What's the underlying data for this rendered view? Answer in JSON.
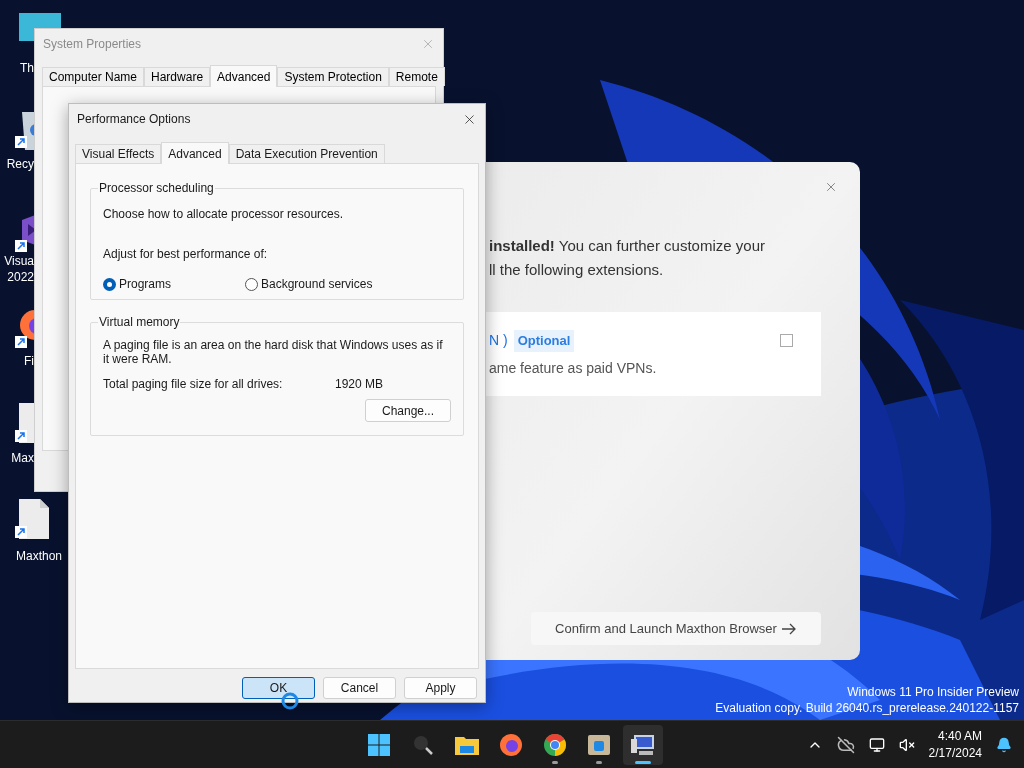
{
  "desktop_icons": [
    {
      "kind": "monitor",
      "lines": [
        "Th"
      ]
    },
    {
      "kind": "bin",
      "lines": [
        "Recy"
      ]
    },
    {
      "kind": "studio",
      "lines": [
        "Visua",
        "2022"
      ]
    },
    {
      "kind": "firefox",
      "lines": [
        "Fi"
      ]
    },
    {
      "kind": "file",
      "lines": [
        "Max"
      ]
    },
    {
      "kind": "file",
      "lines": [
        "Maxthon"
      ]
    }
  ],
  "system_properties": {
    "title": "System Properties",
    "tabs": [
      {
        "label": "Computer Name",
        "selected": false
      },
      {
        "label": "Hardware",
        "selected": false
      },
      {
        "label": "Advanced",
        "selected": true
      },
      {
        "label": "System Protection",
        "selected": false
      },
      {
        "label": "Remote",
        "selected": false
      }
    ]
  },
  "maxthon_dialog": {
    "message": "**installed!** You can further customize your",
    "message_line_2": "ll the following extensions.",
    "extension": {
      "name": "N )",
      "badge": "Optional",
      "description": "ame feature as paid VPNs.",
      "checked": false
    },
    "confirm_button": "Confirm and Launch Maxthon Browser"
  },
  "performance_options": {
    "title": "Performance Options",
    "tabs": [
      {
        "label": "Visual Effects",
        "selected": false
      },
      {
        "label": "Advanced",
        "selected": true
      },
      {
        "label": "Data Execution Prevention",
        "selected": false
      }
    ],
    "processor_scheduling": {
      "legend": "Processor scheduling",
      "intro": "Choose how to allocate processor resources.",
      "prompt": "Adjust for best performance of:",
      "options": [
        {
          "label": "Programs",
          "selected": true
        },
        {
          "label": "Background services",
          "selected": false
        }
      ]
    },
    "virtual_memory": {
      "legend": "Virtual memory",
      "description": "A paging file is an area on the hard disk that Windows uses as if it were RAM.",
      "total_label": "Total paging file size for all drives:",
      "total_value": "1920 MB",
      "change_button": "Change..."
    },
    "buttons": [
      {
        "label": "OK",
        "focused": true
      },
      {
        "label": "Cancel",
        "focused": false
      },
      {
        "label": "Apply",
        "focused": false
      }
    ]
  },
  "watermark_os": [
    "Windows 11 Pro Insider Preview",
    "Evaluation copy. Build 26040.rs_prerelease.240122-1157"
  ],
  "taskbar": {
    "items": [
      {
        "kind": "start",
        "running": false,
        "active": false
      },
      {
        "kind": "search",
        "running": false,
        "active": false
      },
      {
        "kind": "folder",
        "running": false,
        "active": false
      },
      {
        "kind": "firefox",
        "running": false,
        "active": false
      },
      {
        "kind": "chrome",
        "running": true,
        "active": false
      },
      {
        "kind": "maxthon",
        "running": true,
        "active": false
      },
      {
        "kind": "sysprops",
        "running": true,
        "active": true
      }
    ],
    "time": "4:40 AM",
    "date": "2/17/2024"
  }
}
